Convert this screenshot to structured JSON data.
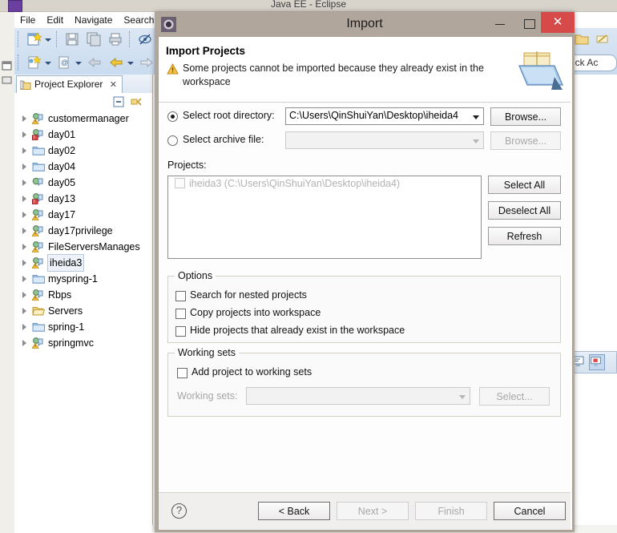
{
  "eclipse": {
    "window_title": "Java EE - Eclipse",
    "menu": [
      "File",
      "Edit",
      "Navigate",
      "Search"
    ],
    "quick_access": "Quick Ac",
    "project_explorer": {
      "tab_label": "Project Explorer",
      "close_glyph": "✕",
      "items": [
        {
          "label": "customermanager",
          "icon": "java-project-warning-icon"
        },
        {
          "label": "day01",
          "icon": "java-project-error-icon"
        },
        {
          "label": "day02",
          "icon": "folder-blue-icon"
        },
        {
          "label": "day04",
          "icon": "folder-blue-icon"
        },
        {
          "label": "day05",
          "icon": "java-project-icon"
        },
        {
          "label": "day13",
          "icon": "java-project-error-icon"
        },
        {
          "label": "day17",
          "icon": "java-project-warning-icon"
        },
        {
          "label": "day17privilege",
          "icon": "java-project-warning-icon"
        },
        {
          "label": "FileServersManages",
          "icon": "java-project-warning-icon"
        },
        {
          "label": "iheida3",
          "icon": "java-project-warning-icon",
          "selected": true
        },
        {
          "label": "myspring-1",
          "icon": "folder-blue-icon"
        },
        {
          "label": "Rbps",
          "icon": "java-project-warning-icon"
        },
        {
          "label": "Servers",
          "icon": "folder-open-icon"
        },
        {
          "label": "spring-1",
          "icon": "folder-blue-icon"
        },
        {
          "label": "springmvc",
          "icon": "java-project-warning-icon"
        }
      ]
    }
  },
  "dialog": {
    "title": "Import",
    "icon": "eclipse-wizard-icon",
    "titlebar": {
      "minimize": "minimize-icon",
      "maximize": "maximize-icon",
      "close": "✕"
    },
    "header": {
      "title": "Import Projects",
      "warning_icon": "warning-triangle-icon",
      "message": "Some projects cannot be imported because they already exist in the workspace",
      "banner_icon": "import-folder-banner-icon"
    },
    "source": {
      "root_directory": {
        "label": "Select root directory:",
        "selected": true,
        "value": "C:\\Users\\QinShuiYan\\Desktop\\iheida4",
        "browse_label": "Browse...",
        "browse_enabled": true
      },
      "archive_file": {
        "label": "Select archive file:",
        "selected": false,
        "value": "",
        "browse_label": "Browse...",
        "browse_enabled": false
      }
    },
    "projects": {
      "label": "Projects:",
      "rows": [
        {
          "label": "iheida3 (C:\\Users\\QinShuiYan\\Desktop\\iheida4)",
          "checked": false,
          "enabled": false
        }
      ],
      "buttons": [
        {
          "label": "Select All",
          "enabled": true
        },
        {
          "label": "Deselect All",
          "enabled": true
        },
        {
          "label": "Refresh",
          "enabled": true
        }
      ]
    },
    "options": {
      "title": "Options",
      "checkboxes": [
        {
          "label": "Search for nested projects",
          "checked": false
        },
        {
          "label": "Copy projects into workspace",
          "checked": false
        },
        {
          "label": "Hide projects that already exist in the workspace",
          "checked": false
        }
      ]
    },
    "working_sets": {
      "title": "Working sets",
      "add_checkbox": {
        "label": "Add project to working sets",
        "checked": false
      },
      "combo_label": "Working sets:",
      "combo_value": "",
      "combo_enabled": false,
      "select_label": "Select...",
      "select_enabled": false
    },
    "footer": {
      "help_glyph": "?",
      "back_label": "< Back",
      "back_enabled": true,
      "next_label": "Next >",
      "next_enabled": false,
      "finish_label": "Finish",
      "finish_enabled": false,
      "cancel_label": "Cancel",
      "cancel_enabled": true
    }
  },
  "colors": {
    "dialog_frame": "#b0a69b",
    "close_red": "#d64a4a",
    "warning_yellow": "#f0b429",
    "toolbar_blue": "#cfdeef"
  }
}
